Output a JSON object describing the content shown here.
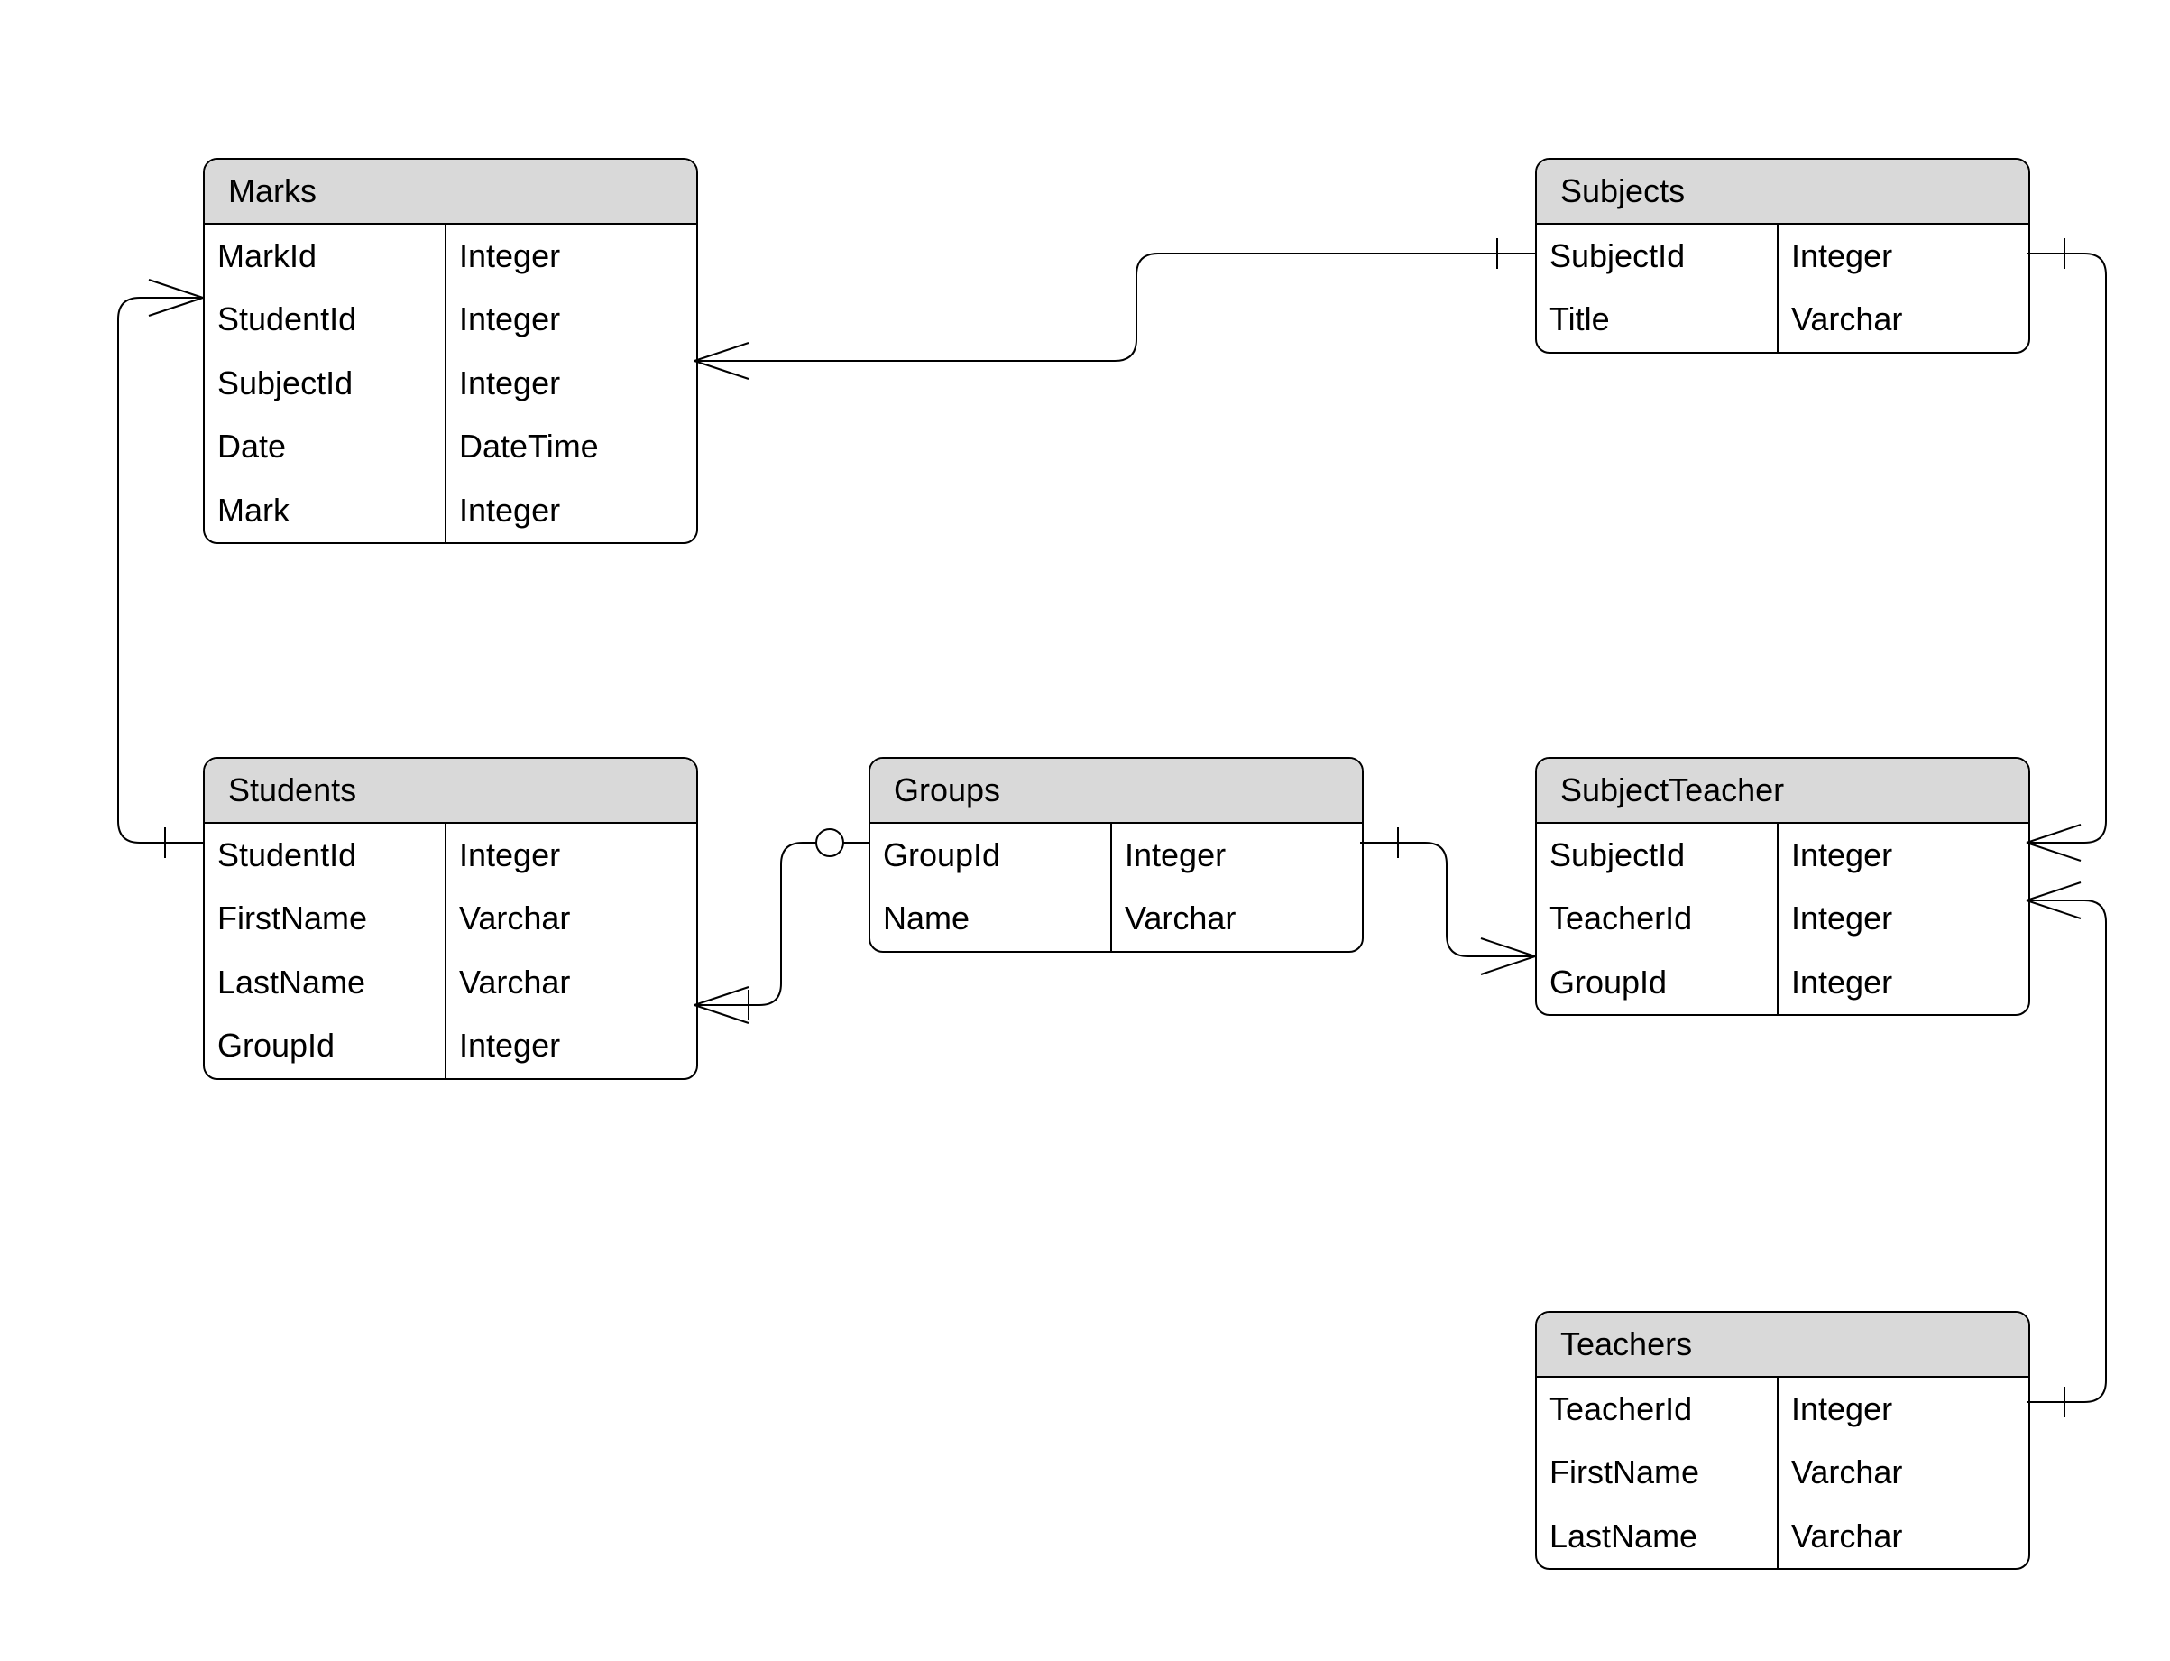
{
  "entities": {
    "marks": {
      "title": "Marks",
      "fields": [
        {
          "name": "MarkId",
          "type": "Integer"
        },
        {
          "name": "StudentId",
          "type": "Integer"
        },
        {
          "name": "SubjectId",
          "type": "Integer"
        },
        {
          "name": "Date",
          "type": "DateTime"
        },
        {
          "name": "Mark",
          "type": "Integer"
        }
      ]
    },
    "subjects": {
      "title": "Subjects",
      "fields": [
        {
          "name": "SubjectId",
          "type": "Integer"
        },
        {
          "name": "Title",
          "type": "Varchar"
        }
      ]
    },
    "students": {
      "title": "Students",
      "fields": [
        {
          "name": "StudentId",
          "type": "Integer"
        },
        {
          "name": "FirstName",
          "type": "Varchar"
        },
        {
          "name": "LastName",
          "type": "Varchar"
        },
        {
          "name": "GroupId",
          "type": "Integer"
        }
      ]
    },
    "groups": {
      "title": "Groups",
      "fields": [
        {
          "name": "GroupId",
          "type": "Integer"
        },
        {
          "name": "Name",
          "type": "Varchar"
        }
      ]
    },
    "subject_teacher": {
      "title": "SubjectTeacher",
      "fields": [
        {
          "name": "SubjectId",
          "type": "Integer"
        },
        {
          "name": "TeacherId",
          "type": "Integer"
        },
        {
          "name": "GroupId",
          "type": "Integer"
        }
      ]
    },
    "teachers": {
      "title": "Teachers",
      "fields": [
        {
          "name": "TeacherId",
          "type": "Integer"
        },
        {
          "name": "FirstName",
          "type": "Varchar"
        },
        {
          "name": "LastName",
          "type": "Varchar"
        }
      ]
    }
  },
  "relationships": [
    {
      "from": "Marks.SubjectId",
      "to": "Subjects.SubjectId",
      "type": "many-to-one"
    },
    {
      "from": "Marks.StudentId",
      "to": "Students.StudentId",
      "type": "many-to-one"
    },
    {
      "from": "Students.GroupId",
      "to": "Groups.GroupId",
      "type": "many-to-zero-or-one"
    },
    {
      "from": "SubjectTeacher.GroupId",
      "to": "Groups.GroupId",
      "type": "many-to-one"
    },
    {
      "from": "SubjectTeacher.SubjectId",
      "to": "Subjects.SubjectId",
      "type": "many-to-one"
    },
    {
      "from": "SubjectTeacher.TeacherId",
      "to": "Teachers.TeacherId",
      "type": "many-to-one"
    }
  ]
}
